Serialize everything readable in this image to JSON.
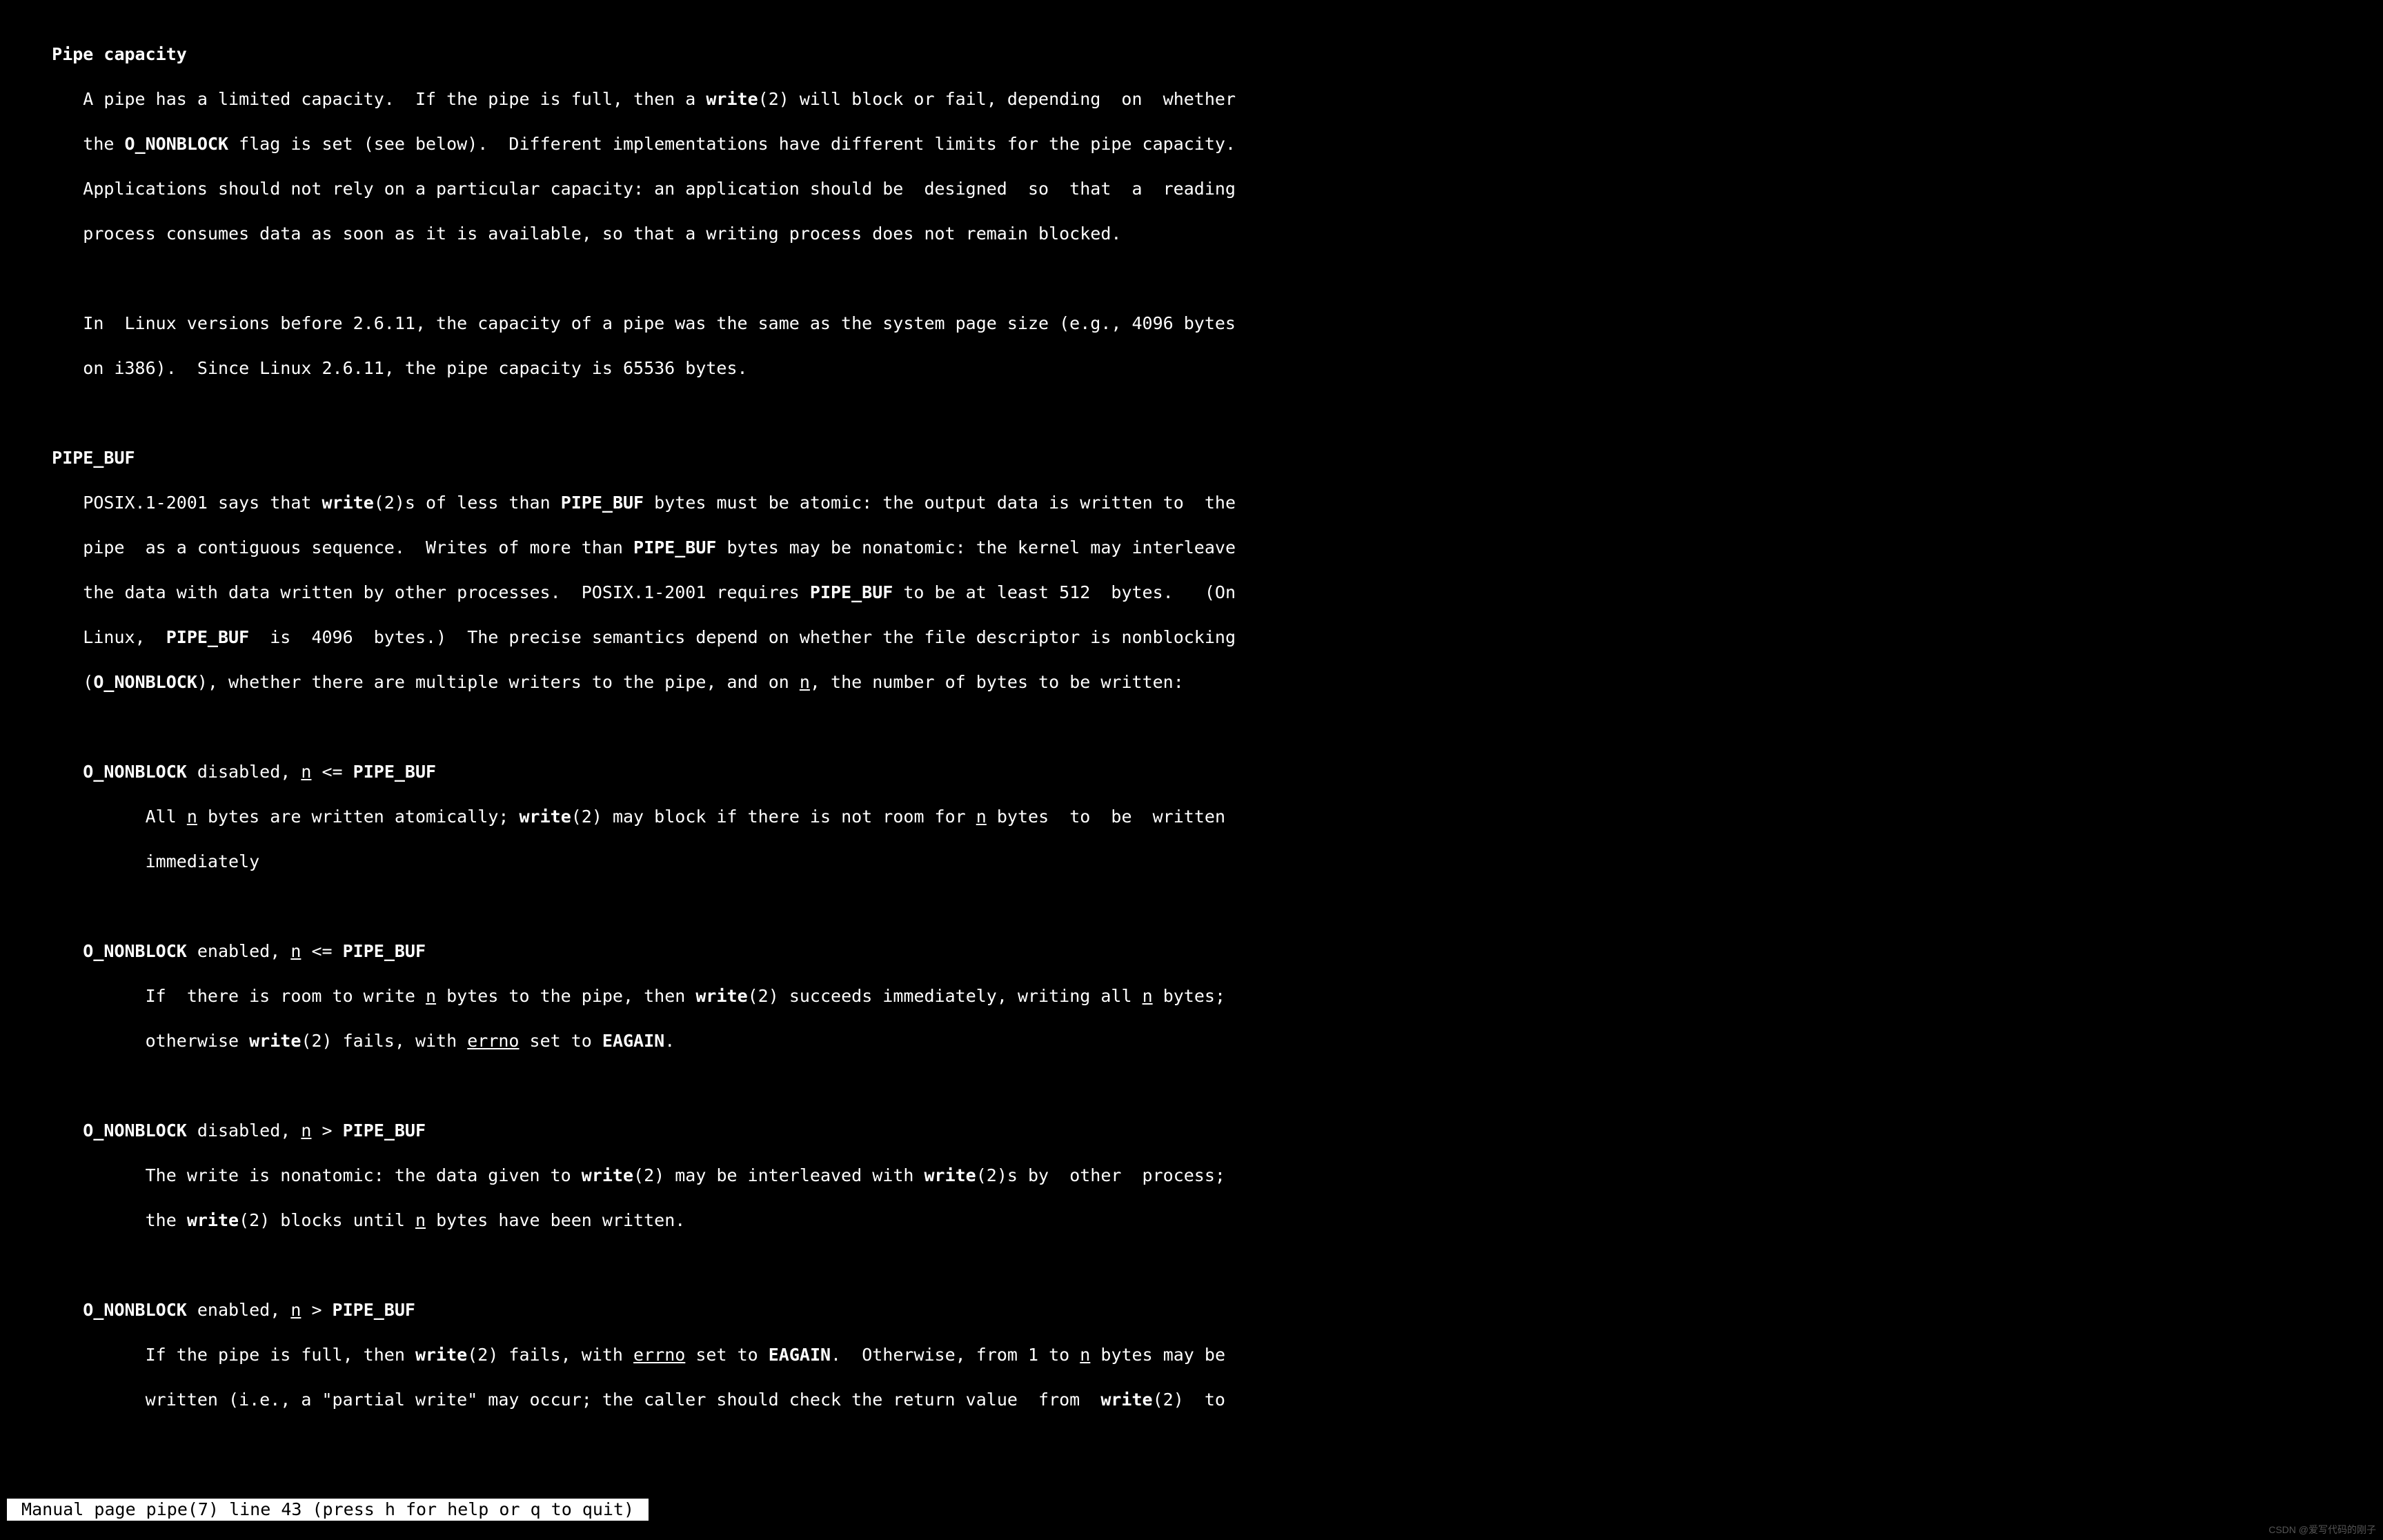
{
  "section1_title": "Pipe capacity",
  "section1_p1_a": "A pipe has a limited capacity.  If the pipe is full, then a ",
  "section1_p1_b": "write",
  "section1_p1_c": "(2) will block or fail, depending  on  whether",
  "section1_p1_d": "the ",
  "section1_p1_e": "O_NONBLOCK",
  "section1_p1_f": " flag is set (see below).  Different implementations have different limits for the pipe capacity.",
  "section1_p1_g": "Applications should not rely on a particular capacity: an application should be  designed  so  that  a  reading",
  "section1_p1_h": "process consumes data as soon as it is available, so that a writing process does not remain blocked.",
  "section1_p2_a": "In  Linux versions before 2.6.11, the capacity of a pipe was the same as the system page size (e.g., 4096 bytes",
  "section1_p2_b": "on i386).  Since Linux 2.6.11, the pipe capacity is 65536 bytes.",
  "section2_title": "PIPE_BUF",
  "section2_p1_a": "POSIX.1-2001 says that ",
  "section2_p1_b": "write",
  "section2_p1_c": "(2)s of less than ",
  "section2_p1_d": "PIPE_BUF",
  "section2_p1_e": " bytes must be atomic: the output data is written to  the",
  "section2_p1_f": "pipe  as a contiguous sequence.  Writes of more than ",
  "section2_p1_g": "PIPE_BUF",
  "section2_p1_h": " bytes may be nonatomic: the kernel may interleave",
  "section2_p1_i": "the data with data written by other processes.  POSIX.1-2001 requires ",
  "section2_p1_j": "PIPE_BUF",
  "section2_p1_k": " to be at least 512  bytes.   (On",
  "section2_p1_l": "Linux,  ",
  "section2_p1_m": "PIPE_BUF",
  "section2_p1_n": "  is  4096  bytes.)  The precise semantics depend on whether the file descriptor is nonblocking",
  "section2_p1_o": "(",
  "section2_p1_p": "O_NONBLOCK",
  "section2_p1_q": "), whether there are multiple writers to the pipe, and on ",
  "section2_p1_r": "n",
  "section2_p1_s": ", the number of bytes to be written:",
  "case1_h_a": "O_NONBLOCK",
  "case1_h_b": " disabled, ",
  "case1_h_c": "n",
  "case1_h_d": " <= ",
  "case1_h_e": "PIPE_BUF",
  "case1_b_a": "All ",
  "case1_b_b": "n",
  "case1_b_c": " bytes are written atomically; ",
  "case1_b_d": "write",
  "case1_b_e": "(2) may block if there is not room for ",
  "case1_b_f": "n",
  "case1_b_g": " bytes  to  be  written",
  "case1_b_h": "immediately",
  "case2_h_a": "O_NONBLOCK",
  "case2_h_b": " enabled, ",
  "case2_h_c": "n",
  "case2_h_d": " <= ",
  "case2_h_e": "PIPE_BUF",
  "case2_b_a": "If  there is room to write ",
  "case2_b_b": "n",
  "case2_b_c": " bytes to the pipe, then ",
  "case2_b_d": "write",
  "case2_b_e": "(2) succeeds immediately, writing all ",
  "case2_b_f": "n",
  "case2_b_g": " bytes;",
  "case2_b_h": "otherwise ",
  "case2_b_i": "write",
  "case2_b_j": "(2) fails, with ",
  "case2_b_k": "errno",
  "case2_b_l": " set to ",
  "case2_b_m": "EAGAIN",
  "case2_b_n": ".",
  "case3_h_a": "O_NONBLOCK",
  "case3_h_b": " disabled, ",
  "case3_h_c": "n",
  "case3_h_d": " > ",
  "case3_h_e": "PIPE_BUF",
  "case3_b_a": "The write is nonatomic: the data given to ",
  "case3_b_b": "write",
  "case3_b_c": "(2) may be interleaved with ",
  "case3_b_d": "write",
  "case3_b_e": "(2)s by  other  process;",
  "case3_b_f": "the ",
  "case3_b_g": "write",
  "case3_b_h": "(2) blocks until ",
  "case3_b_i": "n",
  "case3_b_j": " bytes have been written.",
  "case4_h_a": "O_NONBLOCK",
  "case4_h_b": " enabled, ",
  "case4_h_c": "n",
  "case4_h_d": " > ",
  "case4_h_e": "PIPE_BUF",
  "case4_b_a": "If the pipe is full, then ",
  "case4_b_b": "write",
  "case4_b_c": "(2) fails, with ",
  "case4_b_d": "errno",
  "case4_b_e": " set to ",
  "case4_b_f": "EAGAIN",
  "case4_b_g": ".  Otherwise, from 1 to ",
  "case4_b_h": "n",
  "case4_b_i": " bytes may be",
  "case4_b_j": "written (i.e., a \"partial write\" may occur; the caller should check the return value  from  ",
  "case4_b_k": "write",
  "case4_b_l": "(2)  to",
  "status": " Manual page pipe(7) line 43 (press h for help or q to quit) ",
  "watermark": "CSDN @爱写代码的刚子"
}
